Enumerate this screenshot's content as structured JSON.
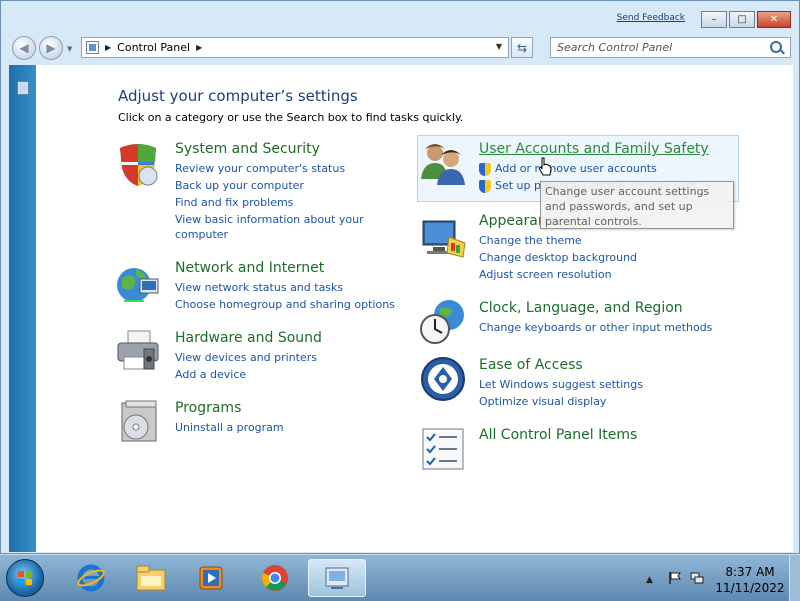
{
  "window": {
    "feedback_label": "Send Feedback",
    "minimize_label": "–",
    "maximize_label": "□",
    "close_label": "✕"
  },
  "nav": {
    "back_icon": "back-arrow-icon",
    "forward_icon": "forward-arrow-icon",
    "breadcrumb_root": "Control Panel",
    "search_placeholder": "Search Control Panel"
  },
  "content": {
    "heading": "Adjust your computer’s settings",
    "subheading": "Click on a category or use the Search box to find tasks quickly.",
    "categories": [
      {
        "title": "System and Security",
        "icon": "shield-icon",
        "links": [
          "Review your computer's status",
          "Back up your computer",
          "Find and fix problems",
          "View basic information about your",
          "computer"
        ]
      },
      {
        "title": "Network and Internet",
        "icon": "globe-network-icon",
        "links": [
          "View network status and tasks",
          "Choose homegroup and sharing options"
        ]
      },
      {
        "title": "Hardware and Sound",
        "icon": "printer-icon",
        "links": [
          "View devices and printers",
          "Add a device"
        ]
      },
      {
        "title": "Programs",
        "icon": "programs-disc-icon",
        "links": [
          "Uninstall a program"
        ]
      },
      {
        "title": "User Accounts and Family Safety",
        "icon": "users-icon",
        "links": [
          "Add or remove user accounts",
          "Set up parental controls for any user"
        ]
      },
      {
        "title": "Appearance",
        "icon": "monitor-paint-icon",
        "links": [
          "Change the theme",
          "Change desktop background",
          "Adjust screen resolution"
        ]
      },
      {
        "title": "Clock, Language, and Region",
        "icon": "clock-globe-icon",
        "links": [
          "Change keyboards or other input methods"
        ]
      },
      {
        "title": "Ease of Access",
        "icon": "ease-of-access-icon",
        "links": [
          "Let Windows suggest settings",
          "Optimize visual display"
        ]
      },
      {
        "title": "All Control Panel Items",
        "icon": "checklist-icon",
        "links": []
      }
    ],
    "tooltip_text": "Change user account settings and passwords, and set up parental controls."
  },
  "taskbar": {
    "time": "8:37 AM",
    "date": "11/11/2022",
    "apps": [
      "internet-explorer-icon",
      "file-explorer-icon",
      "media-player-icon",
      "chrome-icon",
      "control-panel-icon"
    ]
  },
  "colors": {
    "link_blue": "#1c55a8",
    "category_green": "#1a6e2a",
    "heading_blue": "#1e3e7c"
  }
}
